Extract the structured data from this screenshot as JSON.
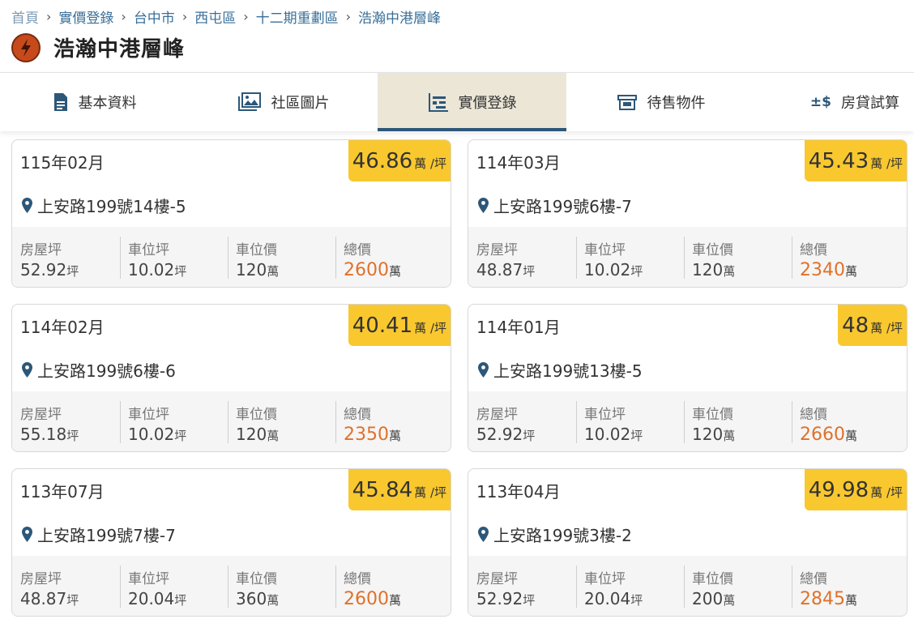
{
  "breadcrumb": [
    "首頁",
    "實價登錄",
    "台中市",
    "西屯區",
    "十二期重劃區",
    "浩瀚中港層峰"
  ],
  "page_title": "浩瀚中港層峰",
  "tabs": [
    {
      "label": "基本資料",
      "icon": "document-icon"
    },
    {
      "label": "社區圖片",
      "icon": "image-gallery-icon"
    },
    {
      "label": "實價登錄",
      "icon": "price-list-icon",
      "active": true
    },
    {
      "label": "待售物件",
      "icon": "storefront-icon"
    },
    {
      "label": "房貸試算",
      "icon": "plus-minus-dollar-icon"
    }
  ],
  "labels": {
    "house_area": "房屋坪",
    "parking_area": "車位坪",
    "parking_price": "車位價",
    "total_price": "總價",
    "ping": "坪",
    "wan": "萬",
    "per_ping": "萬 /坪"
  },
  "colors": {
    "badge": "#f9c82e",
    "total": "#e0712a",
    "accent": "#2c5779",
    "active_tab": "#ebe6d6"
  },
  "cards": [
    {
      "date": "115年02月",
      "unit_price": "46.86",
      "address": "上安路199號14樓-5",
      "house_area": "52.92",
      "parking_area": "10.02",
      "parking_price": "120",
      "total": "2600"
    },
    {
      "date": "114年03月",
      "unit_price": "45.43",
      "address": "上安路199號6樓-7",
      "house_area": "48.87",
      "parking_area": "10.02",
      "parking_price": "120",
      "total": "2340"
    },
    {
      "date": "114年02月",
      "unit_price": "40.41",
      "address": "上安路199號6樓-6",
      "house_area": "55.18",
      "parking_area": "10.02",
      "parking_price": "120",
      "total": "2350"
    },
    {
      "date": "114年01月",
      "unit_price": "48",
      "address": "上安路199號13樓-5",
      "house_area": "52.92",
      "parking_area": "10.02",
      "parking_price": "120",
      "total": "2660"
    },
    {
      "date": "113年07月",
      "unit_price": "45.84",
      "address": "上安路199號7樓-7",
      "house_area": "48.87",
      "parking_area": "20.04",
      "parking_price": "360",
      "total": "2600"
    },
    {
      "date": "113年04月",
      "unit_price": "49.98",
      "address": "上安路199號3樓-2",
      "house_area": "52.92",
      "parking_area": "20.04",
      "parking_price": "200",
      "total": "2845"
    }
  ]
}
